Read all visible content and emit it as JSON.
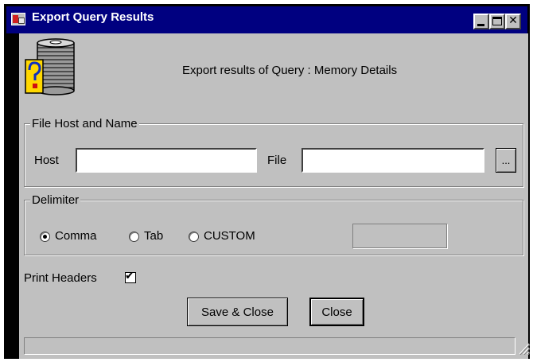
{
  "window": {
    "title": "Export Query Results",
    "controls": {
      "minimize": "_",
      "maximize": "□",
      "close": "✕"
    },
    "colors": {
      "titlebar": "#000080",
      "face": "#c0c0c0"
    }
  },
  "header": {
    "text": "Export results of Query : Memory Details",
    "icon": "database-question-icon"
  },
  "file_group": {
    "label": "File Host and Name",
    "host_label": "Host",
    "host_value": "",
    "file_label": "File",
    "file_value": "",
    "browse_label": "..."
  },
  "delimiter_group": {
    "label": "Delimiter",
    "options": [
      {
        "label": "Comma",
        "selected": true
      },
      {
        "label": "Tab",
        "selected": false
      },
      {
        "label": "CUSTOM",
        "selected": false
      }
    ],
    "custom_value": ""
  },
  "print_headers": {
    "label": "Print Headers",
    "checked": true
  },
  "buttons": {
    "save_close": "Save & Close",
    "close": "Close"
  }
}
